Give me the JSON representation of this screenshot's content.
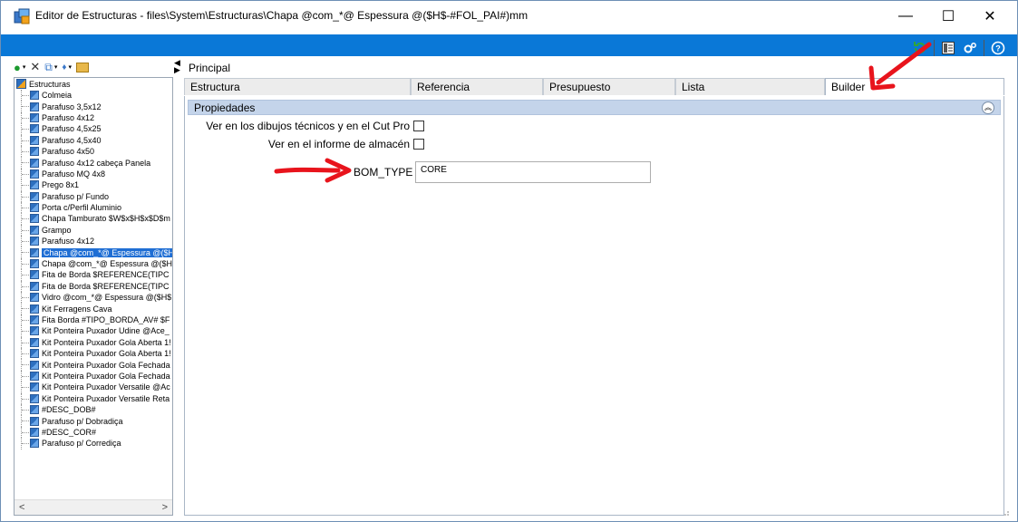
{
  "window": {
    "title": "Editor de Estructuras - files\\System\\Estructuras\\Chapa @com_*@ Espessura @($H$-#FOL_PAI#)mm",
    "minimize": "—",
    "maximize": "☐",
    "close": "✕"
  },
  "toolbar_icons": [
    "refresh-icon",
    "layout-icon",
    "settings-icon",
    "help-icon"
  ],
  "left_toolbar": {
    "add": "●",
    "delete": "✕",
    "copy": "⧉",
    "move": "♦",
    "folder": "▸"
  },
  "tree": {
    "root_label": "Estructuras",
    "items": [
      "Colmeia",
      "Parafuso 3,5x12",
      "Parafuso 4x12",
      "Parafuso 4,5x25",
      "Parafuso 4,5x40",
      "Parafuso 4x50",
      "Parafuso 4x12  cabeça Panela",
      "Parafuso MQ 4x8",
      "Prego 8x1",
      "Parafuso p/ Fundo",
      "Porta c/Perfil Aluminio",
      "Chapa Tamburato $W$x$H$x$D$m",
      "Grampo",
      "Parafuso 4x12",
      "Chapa @com_*@ Espessura @($H",
      "Chapa @com_*@ Espessura @($H",
      "Fita de Borda $REFERENCE(TIPC",
      "Fita de Borda $REFERENCE(TIPC",
      "Vidro @com_*@ Espessura @($H$",
      "Kit Ferragens Cava",
      "Fita Borda #TIPO_BORDA_AV# $F",
      "Kit Ponteira Puxador Udine @Ace_",
      "Kit Ponteira Puxador Gola Aberta 1!",
      "Kit Ponteira Puxador Gola Aberta 1!",
      "Kit Ponteira Puxador Gola Fechada",
      "Kit Ponteira Puxador Gola Fechada",
      "Kit Ponteira Puxador Versatile @Ac",
      "Kit Ponteira Puxador Versatile Reta",
      "#DESC_DOB#",
      "Parafuso p/ Dobradiça",
      "#DESC_COR#",
      "Parafuso p/ Corrediça"
    ],
    "selected_index": 14,
    "scroll_left": "<",
    "scroll_right": ">"
  },
  "principal_label": "Principal",
  "tabs": [
    {
      "label": "Estructura",
      "active": false
    },
    {
      "label": "Referencia",
      "active": false
    },
    {
      "label": "Presupuesto",
      "active": false
    },
    {
      "label": "Lista",
      "active": false
    },
    {
      "label": "Builder",
      "active": true
    }
  ],
  "section": {
    "title": "Propiedades",
    "collapse_symbol": "︽"
  },
  "properties": {
    "cut_pro_label": "Ver en los dibujos técnicos y en el Cut Pro",
    "cut_pro_checked": false,
    "almacen_label": "Ver en el informe de almacén",
    "almacen_checked": false,
    "bom_type_label": "BOM_TYPE",
    "bom_type_value": "CORE"
  },
  "colors": {
    "accent_bar": "#0a78d7",
    "annotation_arrow": "#e8141c",
    "section_bar": "#c4d4ea",
    "selected_item": "#1f6ed4"
  }
}
